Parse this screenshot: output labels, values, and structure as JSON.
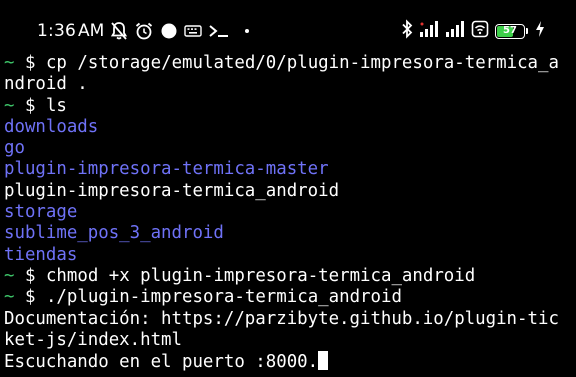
{
  "status_bar": {
    "time": "1:36",
    "ampm": "AM",
    "battery_level": "57",
    "left_icons": [
      "notifications-off-icon",
      "alarm-icon",
      "circle-dot-icon",
      "keyboard-icon",
      "terminal-prompt-icon",
      "small-dot-icon"
    ],
    "right_icons": [
      "bluetooth-icon",
      "signal-icon",
      "signal-icon",
      "wifi-hotspot-icon",
      "battery-icon",
      "charging-icon"
    ],
    "battery_color": "#3ecf4a"
  },
  "terminal": {
    "prompt_symbol": "~",
    "prompt_dollar": "$",
    "colors": {
      "background": "#000000",
      "prompt": "#3ec76a",
      "directory": "#6f72f7",
      "text": "#ffffff"
    },
    "lines": [
      {
        "type": "cmd",
        "text": "cp /storage/emulated/0/plugin-impresora-termica_a"
      },
      {
        "type": "out",
        "text": "ndroid ."
      },
      {
        "type": "cmd",
        "text": "ls"
      },
      {
        "type": "dir",
        "text": "downloads"
      },
      {
        "type": "dir",
        "text": "go"
      },
      {
        "type": "dir",
        "text": "plugin-impresora-termica-master"
      },
      {
        "type": "out",
        "text": "plugin-impresora-termica_android"
      },
      {
        "type": "dir",
        "text": "storage"
      },
      {
        "type": "dir",
        "text": "sublime_pos_3_android"
      },
      {
        "type": "dir",
        "text": "tiendas"
      },
      {
        "type": "cmd",
        "text": "chmod +x plugin-impresora-termica_android"
      },
      {
        "type": "cmd",
        "text": "./plugin-impresora-termica_android"
      },
      {
        "type": "out",
        "text": "Documentación: https://parzibyte.github.io/plugin-tic"
      },
      {
        "type": "out",
        "text": "ket-js/index.html"
      },
      {
        "type": "out_cursor",
        "text": "Escuchando en el puerto :8000."
      }
    ]
  }
}
